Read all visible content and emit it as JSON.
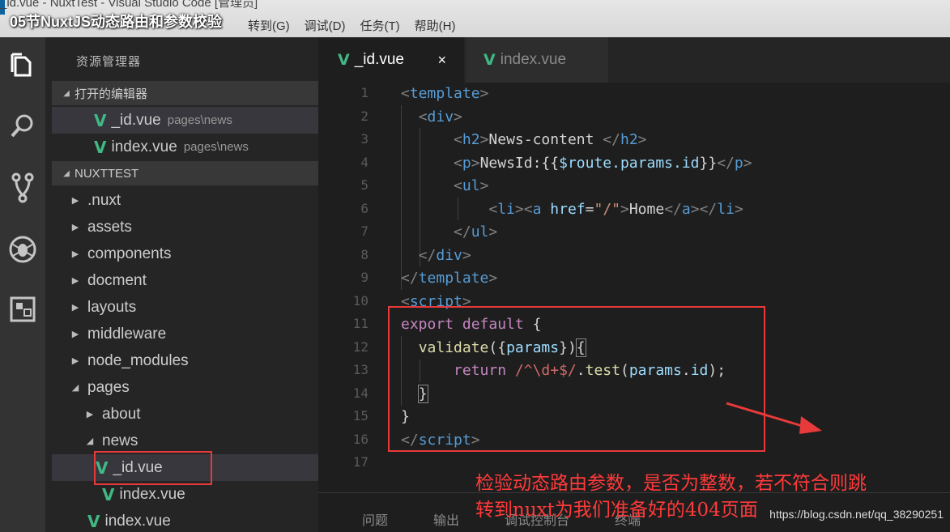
{
  "titlebar": {
    "window_title": "_id.vue - NuxtTest - Visual Studio Code [管理员]",
    "overlay_title": "05节NuxtJS动态路由和参数校验",
    "menus": [
      "转到(G)",
      "调试(D)",
      "任务(T)",
      "帮助(H)"
    ]
  },
  "activity_bar": [
    "explorer-icon",
    "search-icon",
    "source-control-icon",
    "debug-icon",
    "extensions-icon"
  ],
  "sidebar": {
    "title": "资源管理器",
    "open_editors_header": "打开的编辑器",
    "open_editors": [
      {
        "name": "_id.vue",
        "path": "pages\\news"
      },
      {
        "name": "index.vue",
        "path": "pages\\news"
      }
    ],
    "project_header": "NUXTTEST",
    "tree": [
      {
        "name": ".nuxt"
      },
      {
        "name": "assets"
      },
      {
        "name": "components"
      },
      {
        "name": "docment"
      },
      {
        "name": "layouts"
      },
      {
        "name": "middleware"
      },
      {
        "name": "node_modules"
      },
      {
        "name": "pages"
      },
      {
        "name": "about"
      },
      {
        "name": "news"
      },
      {
        "name": "_id.vue"
      },
      {
        "name": "index.vue"
      },
      {
        "name": "index.vue"
      }
    ]
  },
  "tabs": [
    {
      "label": "_id.vue",
      "close": "×"
    },
    {
      "label": "index.vue"
    }
  ],
  "editor": {
    "line_numbers": [
      "1",
      "2",
      "3",
      "4",
      "5",
      "6",
      "7",
      "8",
      "9",
      "10",
      "11",
      "12",
      "13",
      "14",
      "15",
      "16",
      "17"
    ]
  },
  "panel": {
    "tabs": [
      "问题",
      "输出",
      "调试控制台",
      "终端"
    ]
  },
  "annotation": {
    "line1": "检验动态路由参数，是否为整数，若不符合则跳",
    "line2": "转到nuxt为我们准备好的404页面"
  },
  "watermark": "https://blog.csdn.net/qq_38290251",
  "colors": {
    "accent_red": "#e83a3a",
    "vue_green": "#41b883",
    "tag_blue": "#569cd6",
    "keyword_purple": "#c586c0"
  }
}
